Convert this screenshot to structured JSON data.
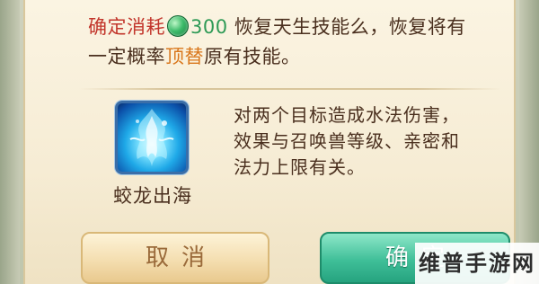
{
  "prompt": {
    "line1_prefix": "确定消耗",
    "cost_icon": "green-jade-icon",
    "cost_amount": "300",
    "line1_suffix": "恢复天生技能么，恢复将有",
    "line2_prefix": "一定概率",
    "line2_highlight": "顶替",
    "line2_suffix": "原有技能。"
  },
  "skill": {
    "icon": "water-dragon-skill-icon",
    "name": "蛟龙出海",
    "description_lines": [
      "对两个目标造成水法伤害，",
      "效果与召唤兽等级、亲密和",
      "法力上限有关。"
    ]
  },
  "buttons": {
    "cancel_label": "取消",
    "confirm_label": "确定"
  },
  "watermark": {
    "text": "维普手游网"
  },
  "colors": {
    "prompt_red": "#c2352b",
    "cost_green": "#2f9a56",
    "highlight_orange": "#d9771c",
    "text_brown": "#4a2f1e",
    "confirm_button": "#3fbf98",
    "cancel_button": "#f4deb0"
  }
}
